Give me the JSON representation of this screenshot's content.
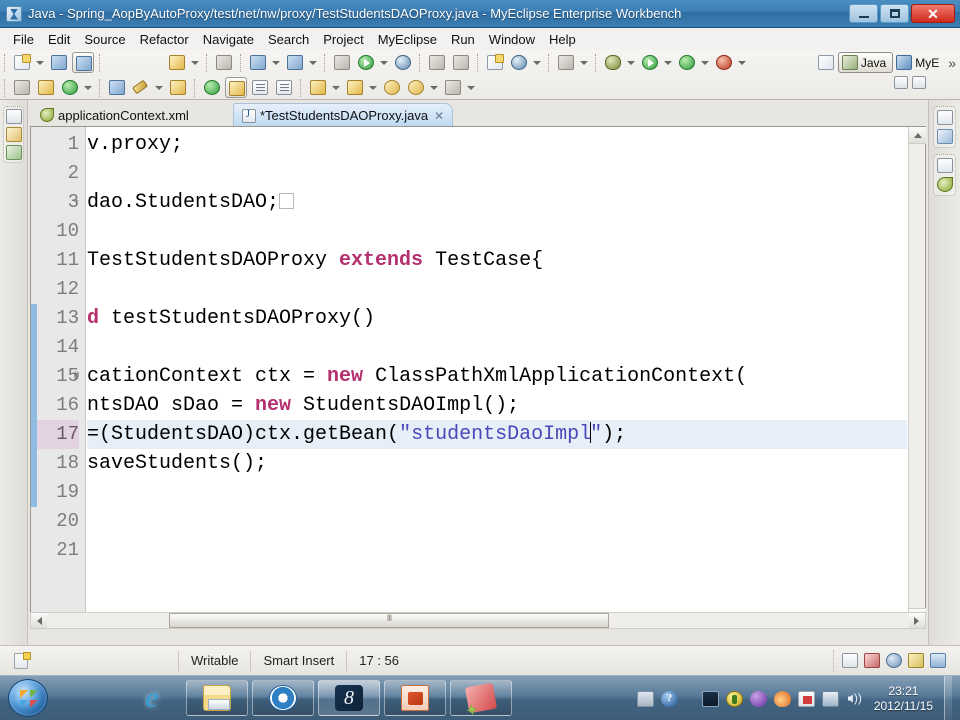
{
  "window": {
    "title": "Java - Spring_AopByAutoProxy/test/net/nw/proxy/TestStudentsDAOProxy.java - MyEclipse Enterprise Workbench",
    "app_icon": "myeclipse-icon",
    "minimize_label": "—",
    "maximize_label": "❐",
    "close_label": "✕"
  },
  "menubar": {
    "items": [
      {
        "label": "File"
      },
      {
        "label": "Edit"
      },
      {
        "label": "Source"
      },
      {
        "label": "Refactor"
      },
      {
        "label": "Navigate"
      },
      {
        "label": "Search"
      },
      {
        "label": "Project"
      },
      {
        "label": "MyEclipse"
      },
      {
        "label": "Run"
      },
      {
        "label": "Window"
      },
      {
        "label": "Help"
      }
    ]
  },
  "toolbar": {
    "perspectives": [
      {
        "label": "Java",
        "icon": "java-perspective-icon",
        "active": true
      },
      {
        "label": "MyE",
        "icon": "myeclipse-perspective-icon",
        "active": false
      }
    ],
    "overflow_label": "»",
    "open_perspective_icon": "open-perspective-icon"
  },
  "left_fastview": {
    "groups": [
      {
        "icons": [
          "restore-icon",
          "package-explorer-icon",
          "hierarchy-icon"
        ]
      }
    ]
  },
  "right_fastview": {
    "groups": [
      {
        "icons": [
          "restore-icon",
          "outline-icon"
        ]
      },
      {
        "icons": [
          "restore-icon",
          "xml-outline-icon"
        ]
      }
    ]
  },
  "editor": {
    "tabs": [
      {
        "label": "applicationContext.xml",
        "icon": "xml-file-icon",
        "active": false,
        "dirty": false
      },
      {
        "label": "*TestStudentsDAOProxy.java",
        "icon": "java-file-icon",
        "active": true,
        "dirty": true,
        "close_label": "✕"
      }
    ],
    "minimize_label": "—",
    "maximize_label": "❐",
    "lines": [
      {
        "number": "1",
        "fold": "",
        "changed": false,
        "current": false,
        "tokens": [
          {
            "t": "text",
            "v": "v.proxy;"
          }
        ]
      },
      {
        "number": "2",
        "fold": "",
        "changed": false,
        "current": false,
        "tokens": [
          {
            "t": "text",
            "v": ""
          }
        ]
      },
      {
        "number": "3",
        "fold": "+",
        "changed": false,
        "current": false,
        "tokens": [
          {
            "t": "text",
            "v": "dao.StudentsDAO;"
          },
          {
            "t": "ghost",
            "v": " "
          }
        ]
      },
      {
        "number": "10",
        "fold": "",
        "changed": false,
        "current": false,
        "tokens": [
          {
            "t": "text",
            "v": ""
          }
        ]
      },
      {
        "number": "11",
        "fold": "",
        "changed": false,
        "current": false,
        "tokens": [
          {
            "t": "text",
            "v": "TestStudentsDAOProxy "
          },
          {
            "t": "kw",
            "v": "extends"
          },
          {
            "t": "text",
            "v": " TestCase{"
          }
        ]
      },
      {
        "number": "12",
        "fold": "",
        "changed": false,
        "current": false,
        "tokens": [
          {
            "t": "text",
            "v": ""
          }
        ]
      },
      {
        "number": "13",
        "fold": "-",
        "changed": true,
        "current": false,
        "tokens": [
          {
            "t": "kw",
            "v": "d"
          },
          {
            "t": "text",
            "v": " testStudentsDAOProxy()"
          }
        ]
      },
      {
        "number": "14",
        "fold": "",
        "changed": true,
        "current": false,
        "tokens": [
          {
            "t": "text",
            "v": ""
          }
        ]
      },
      {
        "number": "15",
        "fold": "@",
        "changed": true,
        "current": false,
        "tokens": [
          {
            "t": "text",
            "v": "cationContext ctx = "
          },
          {
            "t": "kw",
            "v": "new"
          },
          {
            "t": "text",
            "v": " ClassPathXmlApplicationContext("
          }
        ]
      },
      {
        "number": "16",
        "fold": "",
        "changed": true,
        "current": false,
        "tokens": [
          {
            "t": "text",
            "v": "ntsDAO sDao = "
          },
          {
            "t": "kw",
            "v": "new"
          },
          {
            "t": "text",
            "v": " StudentsDAOImpl();"
          }
        ]
      },
      {
        "number": "17",
        "fold": "",
        "changed": true,
        "current": true,
        "tokens": [
          {
            "t": "text",
            "v": "=(StudentsDAO)ctx.getBean("
          },
          {
            "t": "str",
            "v": "\"studentsDaoImpl"
          },
          {
            "t": "cursor",
            "v": ""
          },
          {
            "t": "str",
            "v": "\""
          },
          {
            "t": "text",
            "v": ");"
          }
        ]
      },
      {
        "number": "18",
        "fold": "",
        "changed": true,
        "current": false,
        "tokens": [
          {
            "t": "text",
            "v": "saveStudents();"
          }
        ]
      },
      {
        "number": "19",
        "fold": "",
        "changed": true,
        "current": false,
        "tokens": [
          {
            "t": "text",
            "v": ""
          }
        ]
      },
      {
        "number": "20",
        "fold": "",
        "changed": false,
        "current": false,
        "tokens": [
          {
            "t": "text",
            "v": ""
          }
        ]
      },
      {
        "number": "21",
        "fold": "",
        "changed": false,
        "current": false,
        "tokens": [
          {
            "t": "text",
            "v": ""
          }
        ]
      }
    ]
  },
  "statusbar": {
    "icon": "writable-doc-icon",
    "writable": "Writable",
    "insert_mode": "Smart Insert",
    "position": "17 : 56",
    "tray_icons": [
      "restore-icon",
      "user-icon",
      "at-icon",
      "lifebuoy-icon",
      "monitor-icon"
    ]
  },
  "taskbar": {
    "start_label": "start-orb",
    "quicklaunch": [
      {
        "icon": "internet-explorer-icon"
      }
    ],
    "buttons": [
      {
        "icon": "folder-window-icon",
        "selected": false
      },
      {
        "icon": "sogou-browser-icon",
        "selected": false
      },
      {
        "icon": "eight-app-icon",
        "selected": true
      },
      {
        "icon": "powerpoint-icon",
        "selected": false
      },
      {
        "icon": "screen-recorder-icon",
        "selected": false
      }
    ],
    "tray": [
      {
        "icon": "keyboard-icon"
      },
      {
        "icon": "help-icon"
      },
      {
        "icon": "show-hidden-icon"
      },
      {
        "icon": "monitor-icon"
      },
      {
        "icon": "update-icon"
      },
      {
        "icon": "colorful-icon"
      },
      {
        "icon": "fire-icon"
      },
      {
        "icon": "action-center-flag-icon"
      },
      {
        "icon": "network-icon"
      },
      {
        "icon": "volume-icon"
      }
    ],
    "clock_time": "23:21",
    "clock_date": "2012/11/15"
  }
}
